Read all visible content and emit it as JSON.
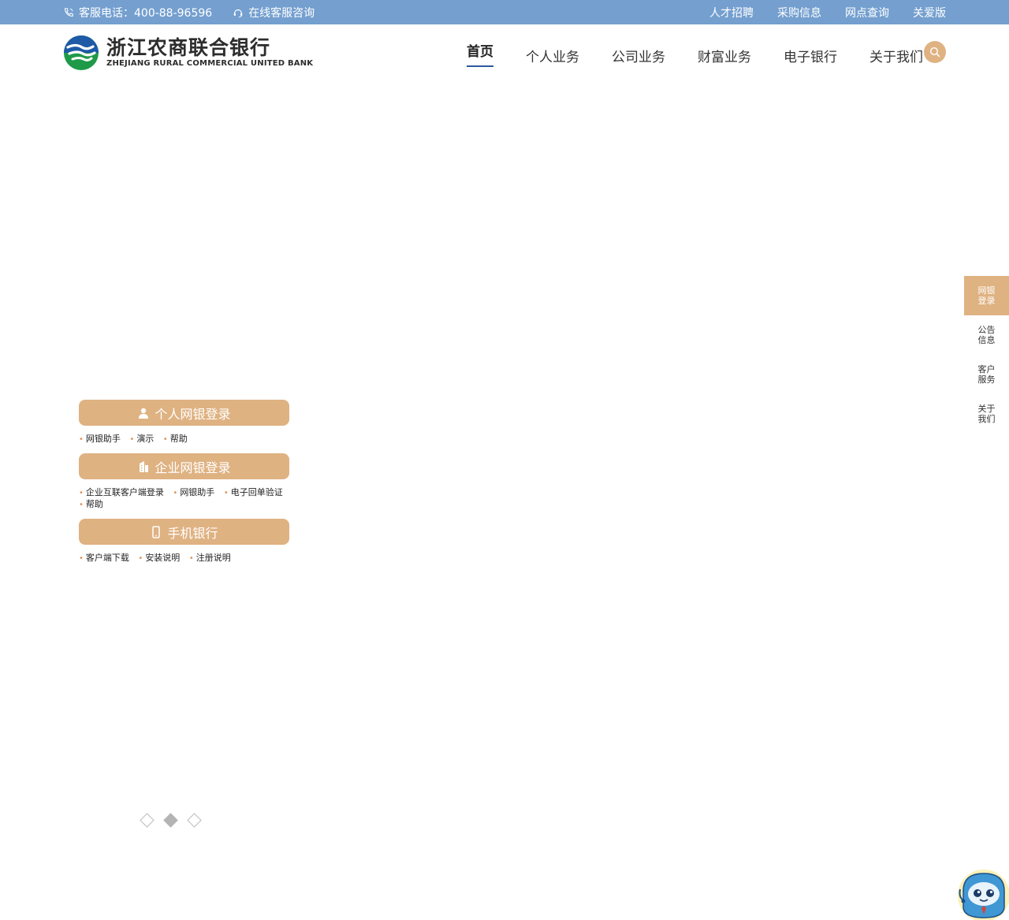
{
  "topbar": {
    "hotline": "客服电话：400-88-96596",
    "online_service": "在线客服咨询",
    "links": [
      "人才招聘",
      "采购信息",
      "网点查询",
      "关爱版"
    ]
  },
  "logo": {
    "cn": "浙江农商联合银行",
    "en": "ZHEJIANG RURAL COMMERCIAL UNITED BANK"
  },
  "nav": [
    "首页",
    "个人业务",
    "公司业务",
    "财富业务",
    "电子银行",
    "关于我们"
  ],
  "login": {
    "personal": {
      "label": "个人网银登录",
      "links": [
        "网银助手",
        "演示",
        "帮助"
      ]
    },
    "corporate": {
      "label": "企业网银登录",
      "links": [
        "企业互联客户端登录",
        "网银助手",
        "电子回单验证",
        "帮助"
      ]
    },
    "mobile": {
      "label": "手机银行",
      "links": [
        "客户端下载",
        "安装说明",
        "注册说明"
      ]
    }
  },
  "sidebar": [
    {
      "line1": "网银",
      "line2": "登录"
    },
    {
      "line1": "公告",
      "line2": "信息"
    },
    {
      "line1": "客户",
      "line2": "服务"
    },
    {
      "line1": "关于",
      "line2": "我们"
    }
  ],
  "colors": {
    "topbar": "#749fcf",
    "accent": "#dfb282",
    "nav_underline": "#2a5a9c"
  },
  "carousel": {
    "count": 3,
    "active_index": 1
  }
}
